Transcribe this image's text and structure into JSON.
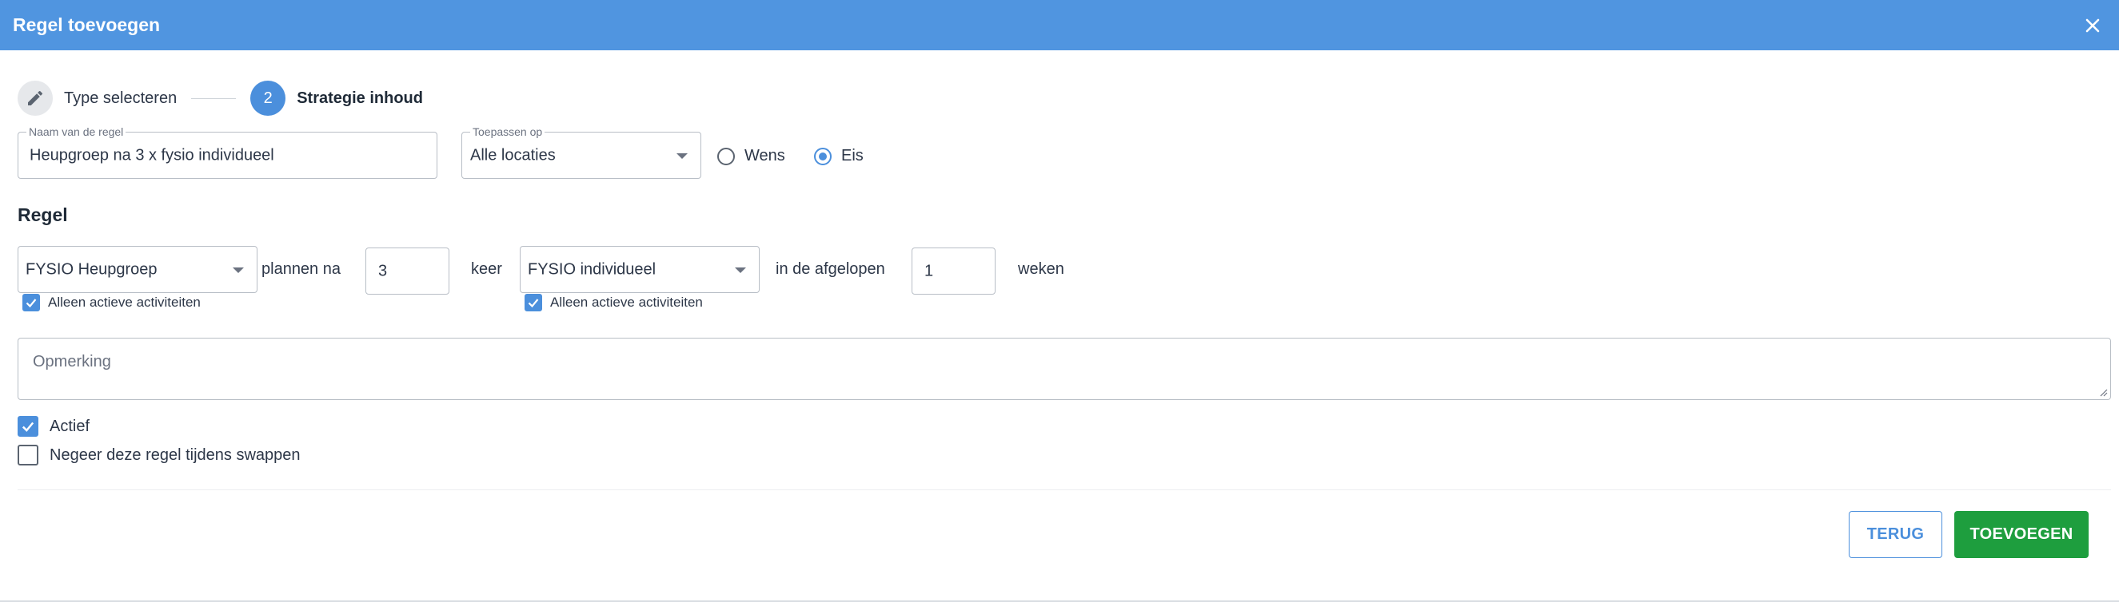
{
  "dialog": {
    "title": "Regel toevoegen",
    "close_icon": "close-icon"
  },
  "stepper": {
    "steps": [
      {
        "label": "Type selecteren",
        "icon": "pencil-icon",
        "state": "done"
      },
      {
        "label": "Strategie inhoud",
        "number": "2",
        "state": "active"
      }
    ]
  },
  "form": {
    "name": {
      "label": "Naam van de regel",
      "value": "Heupgroep na 3 x fysio individueel"
    },
    "apply_to": {
      "label": "Toepassen op",
      "value": "Alle locaties"
    },
    "type_options": [
      {
        "label": "Wens",
        "checked": false
      },
      {
        "label": "Eis",
        "checked": true
      }
    ]
  },
  "rule": {
    "title": "Regel",
    "activity_a": "FYSIO Heupgroep",
    "text_plan_after": "plannen na",
    "count": "3",
    "text_times": "keer",
    "activity_b": "FYSIO individueel",
    "text_in_last": "in de afgelopen",
    "weeks": "1",
    "text_weeks": "weken",
    "only_active_a": {
      "label": "Alleen actieve activiteiten",
      "checked": true
    },
    "only_active_b": {
      "label": "Alleen actieve activiteiten",
      "checked": true
    }
  },
  "remark": {
    "placeholder": "Opmerking"
  },
  "options": {
    "active": {
      "label": "Actief",
      "checked": true
    },
    "ignore_swap": {
      "label": "Negeer deze regel tijdens swappen",
      "checked": false
    }
  },
  "actions": {
    "back_label": "TERUG",
    "add_label": "TOEVOEGEN"
  },
  "colors": {
    "header": "#5095e0",
    "accent": "#4b8fdc",
    "primary_button": "#1e9e3e"
  }
}
